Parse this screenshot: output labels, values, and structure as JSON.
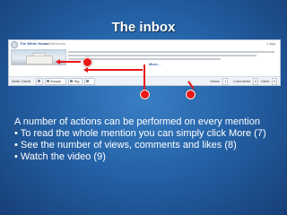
{
  "slide": {
    "title": "The inbox",
    "body_lines": [
      "A number of actions can be performed on every mention",
      "• To read the whole mention you can simply click More (7)",
      "• See the number of views, comments and likes (8)",
      "• Watch the video (9)"
    ]
  },
  "screenshot": {
    "source_name": "The White House",
    "via_text": "via Wikimedia",
    "page_indicator": "1 ago",
    "more_link": "More...",
    "toolbar": {
      "media_label": "Aktie Check",
      "assign_label": "Assign",
      "tag_label": "Tag",
      "views_label": "Views",
      "views_value": "1",
      "comments_label": "Comments",
      "comments_value": "0",
      "likes_label": "Likes",
      "likes_value": "0"
    }
  },
  "colors": {
    "annotation_red": "#e81818",
    "background_blue": "#2563a8",
    "link_blue": "#2d5ca8"
  },
  "icons": [
    "play-icon",
    "assign-icon",
    "tag-icon",
    "share-icon"
  ]
}
